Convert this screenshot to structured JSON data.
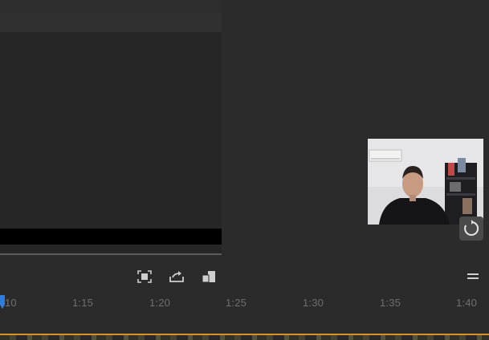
{
  "timeline": {
    "ticks": [
      "10",
      "1:15",
      "1:20",
      "1:25",
      "1:30",
      "1:35",
      "1:40"
    ]
  },
  "icons": {
    "fit": "fit-to-frame-icon",
    "export": "export-frame-icon",
    "compare": "compare-view-icon",
    "menu": "hamburger-menu-icon",
    "refresh": "refresh-icon"
  },
  "colors": {
    "playhead": "#2f7de1",
    "track_accent": "#d9922a"
  }
}
